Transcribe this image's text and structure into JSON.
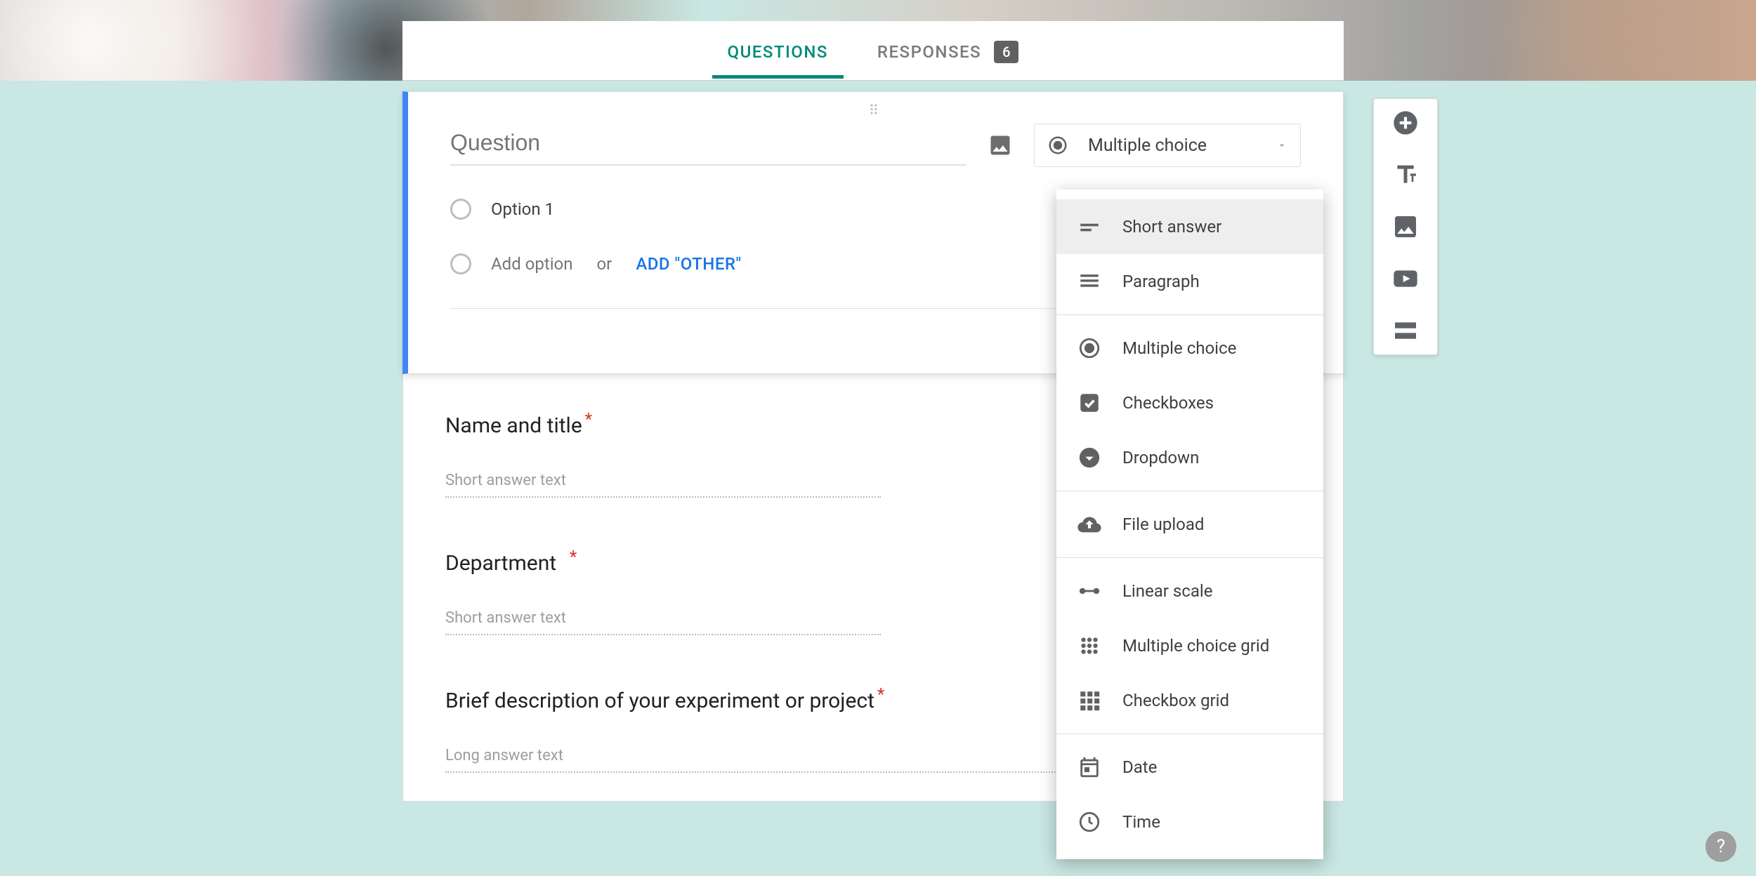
{
  "tabs": {
    "questions": "QUESTIONS",
    "responses": "RESPONSES",
    "responses_count": "6"
  },
  "editor": {
    "question_placeholder": "Question",
    "option1_label": "Option 1",
    "add_option": "Add option",
    "or": "or",
    "add_other": "ADD \"OTHER\""
  },
  "type_selector": {
    "current": "Multiple choice"
  },
  "dropdown": {
    "short_answer": "Short answer",
    "paragraph": "Paragraph",
    "multiple_choice": "Multiple choice",
    "checkboxes": "Checkboxes",
    "dropdown": "Dropdown",
    "file_upload": "File upload",
    "linear_scale": "Linear scale",
    "mc_grid": "Multiple choice grid",
    "cb_grid": "Checkbox grid",
    "date": "Date",
    "time": "Time"
  },
  "questions": {
    "q1": {
      "label": "Name and title",
      "placeholder": "Short answer text"
    },
    "q2": {
      "label": "Department",
      "placeholder": "Short answer text"
    },
    "q3": {
      "label": "Brief description of your experiment or project",
      "placeholder": "Long answer text"
    }
  },
  "help_label": "?"
}
